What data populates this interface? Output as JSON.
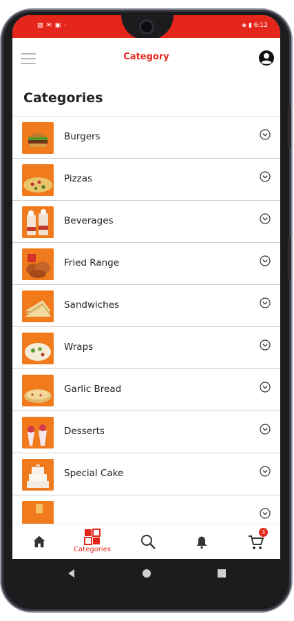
{
  "status_bar": {
    "time": "6:12",
    "left_icons": "▧ ✉ ▣ ·"
  },
  "app_bar": {
    "title": "Category"
  },
  "page": {
    "title": "Categories"
  },
  "categories": [
    {
      "label": "Burgers",
      "icon": "burger-thumb"
    },
    {
      "label": "Pizzas",
      "icon": "pizza-thumb"
    },
    {
      "label": "Beverages",
      "icon": "beverage-thumb"
    },
    {
      "label": "Fried Range",
      "icon": "fried-thumb"
    },
    {
      "label": "Sandwiches",
      "icon": "sandwich-thumb"
    },
    {
      "label": "Wraps",
      "icon": "wrap-thumb"
    },
    {
      "label": "Garlic Bread",
      "icon": "garlic-bread-thumb"
    },
    {
      "label": "Desserts",
      "icon": "dessert-thumb"
    },
    {
      "label": "Special Cake",
      "icon": "cake-thumb"
    }
  ],
  "bottom_nav": {
    "active_label": "Categories",
    "cart_count": "3",
    "items": [
      "home-icon",
      "categories-icon",
      "search-icon",
      "bell-icon",
      "cart-icon"
    ]
  },
  "colors": {
    "accent": "#e5261c",
    "thumb_bg": "#f07a1c",
    "divider": "#cfcfcf"
  }
}
